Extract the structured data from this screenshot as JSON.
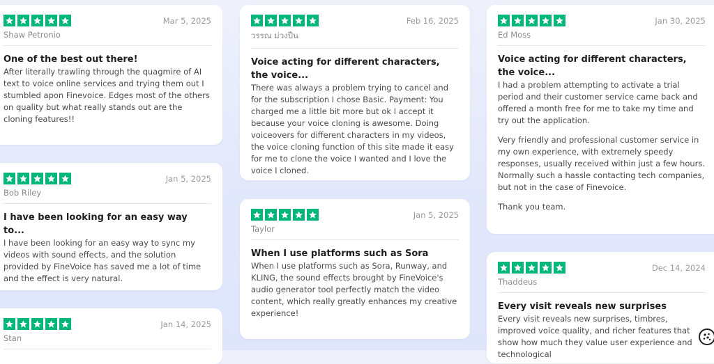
{
  "colors": {
    "star_bg": "#00b67a",
    "star_fg": "#ffffff",
    "background": "#e3e8fb"
  },
  "star_icon": "star-icon",
  "reviews": [
    {
      "rating": 5,
      "date": "Mar 5, 2025",
      "author": "Shaw Petronio",
      "title": "One of the best out there!",
      "paragraphs": [
        "After literally trawling through the quagmire of AI text to voice online services and trying them out I stumbled apon Finevoice. Edges most of the others on quality but what really stands out are the cloning features!!"
      ]
    },
    {
      "rating": 5,
      "date": "Jan 5, 2025",
      "author": "Bob Riley",
      "title": "I have been looking for an easy way to...",
      "paragraphs": [
        "I have been looking for an easy way to sync my videos with sound effects, and the solution provided by FineVoice has saved me a lot of time and the effect is very natural."
      ]
    },
    {
      "rating": 5,
      "date": "Jan 14, 2025",
      "author": "Stan",
      "title": "",
      "paragraphs": []
    },
    {
      "rating": 5,
      "date": "Feb 16, 2025",
      "author": "วรรณ ม่วงปืน",
      "title": "Voice acting for different characters, the voice...",
      "paragraphs": [
        "There was always a problem trying to cancel and for the subscription I chose Basic. Payment: You charged me a little bit more but ok I accept it because your voice cloning is awesome. Doing voiceovers for different characters in my videos, the voice cloning function of this site made it easy for me to clone the voice I wanted and I love the voice I cloned."
      ]
    },
    {
      "rating": 5,
      "date": "Jan 5, 2025",
      "author": "Taylor",
      "title": "When I use platforms such as Sora",
      "paragraphs": [
        "When I use platforms such as Sora, Runway, and KLING, the sound effects brought by FineVoice's audio generator tool perfectly match the video content, which really greatly enhances my creative experience!"
      ]
    },
    {
      "rating": 5,
      "date": "Jan 30, 2025",
      "author": "Ed Moss",
      "title": "Voice acting for different characters, the voice...",
      "paragraphs": [
        "I had a problem attempting to activate a trial period and their customer service came back and offered a month free for me to take my time and try out the application.",
        "Very friendly and professional customer service in my own experience, with extremely speedy responses, usually received within just a few hours. Normally such a hassle contacting tech companies, but not in the case of Finevoice.",
        "Thank you team."
      ]
    },
    {
      "rating": 5,
      "date": "Dec 14, 2024",
      "author": "Thaddeus",
      "title": "Every visit reveals new surprises",
      "paragraphs": [
        "Every visit reveals new surprises, timbres, improved voice quality, and richer features that show how much they value user experience and technological"
      ]
    }
  ]
}
